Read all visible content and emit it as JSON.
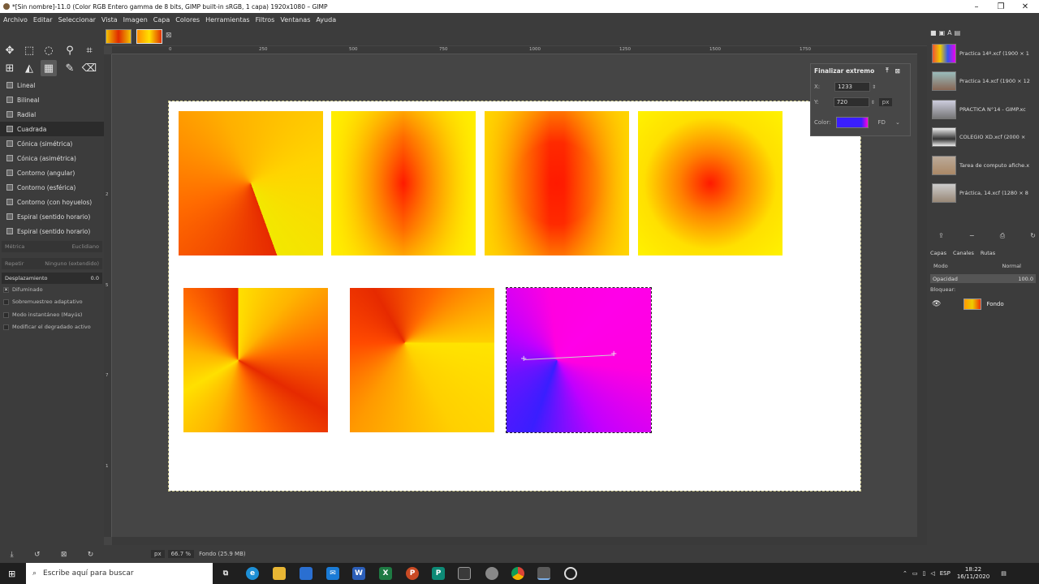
{
  "window": {
    "title": "*[Sin nombre]-11.0 (Color RGB Entero gamma de 8 bits, GIMP built-in sRGB, 1 capa) 1920x1080 – GIMP",
    "minimize": "–",
    "maximize": "❐",
    "close": "✕"
  },
  "menu": [
    "Archivo",
    "Editar",
    "Seleccionar",
    "Vista",
    "Imagen",
    "Capa",
    "Colores",
    "Herramientas",
    "Filtros",
    "Ventanas",
    "Ayuda"
  ],
  "gradient_shapes": [
    "Lineal",
    "Bilineal",
    "Radial",
    "Cuadrada",
    "Cónica (simétrica)",
    "Cónica (asimétrica)",
    "Contorno (angular)",
    "Contorno (esférica)",
    "Contorno (con hoyuelos)",
    "Espiral (sentido horario)",
    "Espiral (sentido horario)"
  ],
  "active_shape": "Cuadrada",
  "tool_options": {
    "metric_label": "Métrica",
    "metric_value": "Euclidiano",
    "repeat_label": "Repetir",
    "repeat_value": "Ninguno (extendido)",
    "offset_label": "Desplazamiento",
    "offset_value": "0.0",
    "dithering": "Difuminado",
    "adaptive": "Sobremuestreo adaptativo",
    "instant": "Modo instantáneo (Mayús)",
    "modify": "Modificar el degradado activo"
  },
  "ruler_ticks": [
    "0",
    "250",
    "500",
    "750",
    "1000",
    "1250",
    "1500",
    "1750"
  ],
  "ruler_v_ticks": [
    "2",
    "5",
    "7",
    "1"
  ],
  "end_dialog": {
    "title": "Finalizar extremo",
    "x_label": "X:",
    "x_value": "1233",
    "y_label": "Y:",
    "y_value": "720",
    "unit": "px",
    "color_label": "Color:",
    "color_mode": "FD",
    "color": "#3a1eff"
  },
  "statusbar": {
    "unit": "px",
    "zoom": "66.7 %",
    "message": "Fondo (25.9 MB)"
  },
  "images_list": [
    "Practica 14º.xcf (1900 × 1",
    "Practica 14.xcf (1900 × 12",
    "PRACTICA N°14 - GIMP.xc",
    "COLEGIO XD.xcf (2000 ×",
    "Tarea de computo afiche.x",
    "Práctica, 14.xcf (1280 × 8"
  ],
  "dock_tabs": [
    "Capas",
    "Canales",
    "Rutas"
  ],
  "layers": {
    "mode_label": "Modo",
    "mode_value": "Normal",
    "opacity_label": "Opacidad",
    "opacity_value": "100.0",
    "lock_label": "Bloquear:",
    "layer_name": "Fondo"
  },
  "taskbar": {
    "search_placeholder": "Escribe aquí para buscar",
    "lang": "ESP",
    "time": "18:22",
    "date": "16/11/2020"
  },
  "colors": {
    "ui_bg": "#454545",
    "panel_bg": "#3c3c3c",
    "accent_fg": "#3a1eff",
    "accent_bg": "#ff00e0"
  }
}
